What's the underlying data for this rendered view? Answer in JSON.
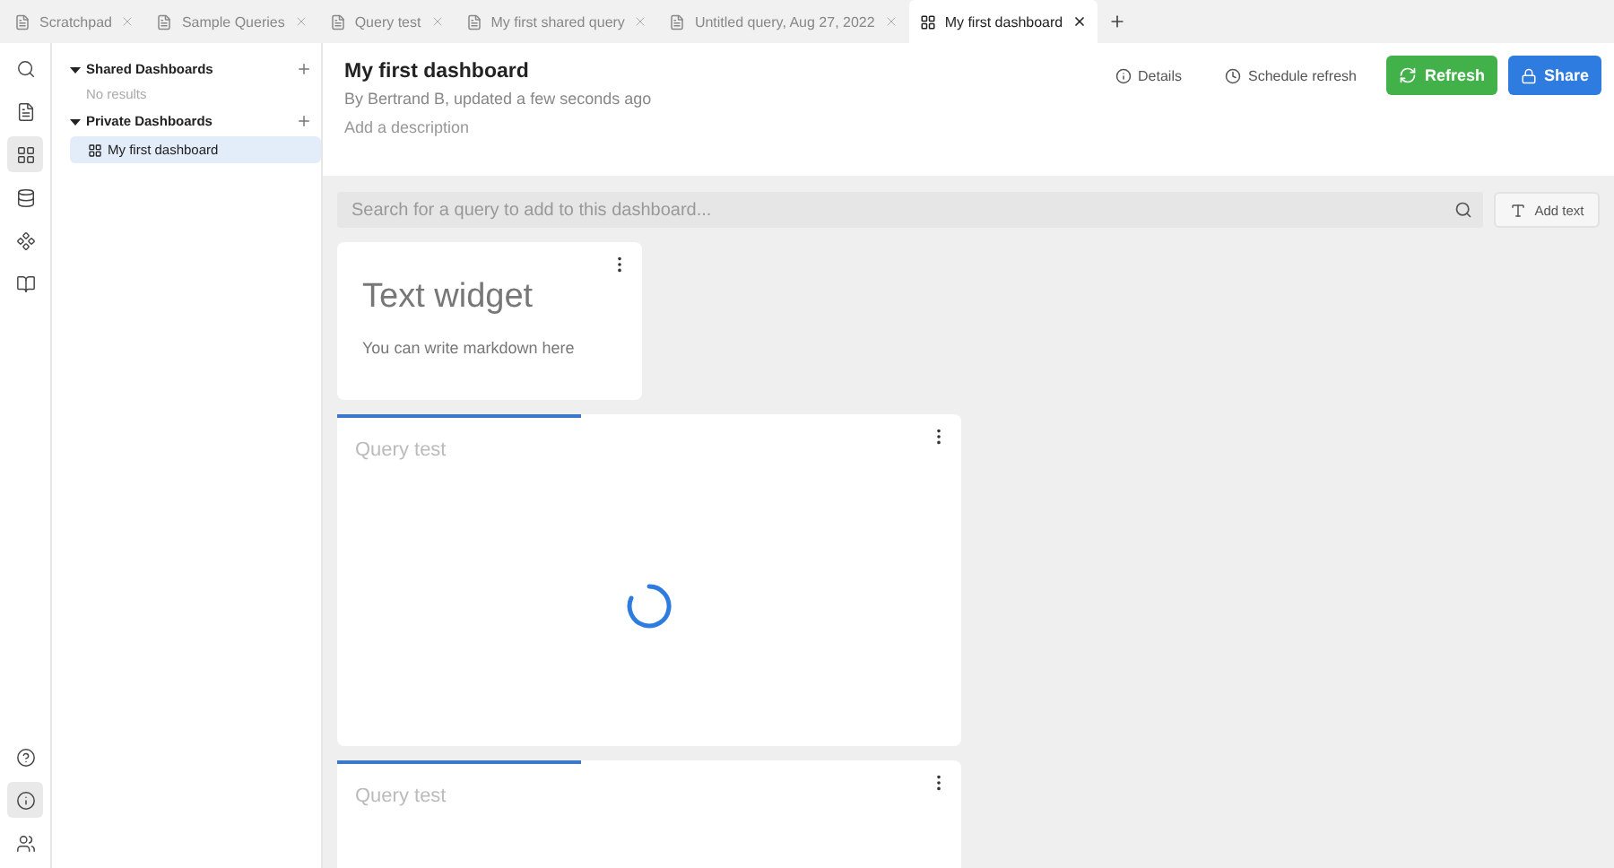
{
  "tabs": [
    {
      "label": "Scratchpad",
      "kind": "query",
      "selected": false
    },
    {
      "label": "Sample Queries",
      "kind": "query",
      "selected": false
    },
    {
      "label": "Query test",
      "kind": "query",
      "selected": false
    },
    {
      "label": "My first shared query",
      "kind": "query",
      "selected": false
    },
    {
      "label": "Untitled query, Aug 27, 2022",
      "kind": "query",
      "selected": false
    },
    {
      "label": "My first dashboard",
      "kind": "dashboard",
      "selected": true
    }
  ],
  "rail": {
    "top": [
      {
        "kind": "search",
        "selected": false
      },
      {
        "kind": "queries",
        "selected": false
      },
      {
        "kind": "dashboards",
        "selected": true
      },
      {
        "kind": "database",
        "selected": false
      },
      {
        "kind": "components",
        "selected": false
      },
      {
        "kind": "docs",
        "selected": false
      }
    ],
    "bottom": [
      {
        "kind": "help",
        "selected": false
      },
      {
        "kind": "info",
        "selected": true
      },
      {
        "kind": "users",
        "selected": false
      }
    ]
  },
  "sidebar": {
    "sections": [
      {
        "title": "Shared Dashboards",
        "expanded": true,
        "empty_text": "No results"
      },
      {
        "title": "Private Dashboards",
        "expanded": true,
        "items": [
          {
            "label": "My first dashboard",
            "selected": true
          }
        ]
      }
    ]
  },
  "dashboard": {
    "title": "My first dashboard",
    "byline": "By Bertrand B, updated a few seconds ago",
    "description_placeholder": "Add a description",
    "actions": [
      {
        "kind": "details",
        "label": "Details"
      },
      {
        "kind": "schedule",
        "label": "Schedule refresh"
      },
      {
        "kind": "refresh",
        "label": "Refresh"
      },
      {
        "kind": "share",
        "label": "Share"
      }
    ],
    "search_placeholder": "Search for a query to add to this dashboard...",
    "add_text": "Add text",
    "widgets": [
      {
        "kind": "text",
        "heading": "Text widget",
        "body": "You can write markdown here"
      },
      {
        "kind": "query",
        "title": "Query test",
        "level": 0.39,
        "loading": true
      },
      {
        "kind": "query",
        "title": "Query test",
        "level": 0.39
      }
    ]
  }
}
